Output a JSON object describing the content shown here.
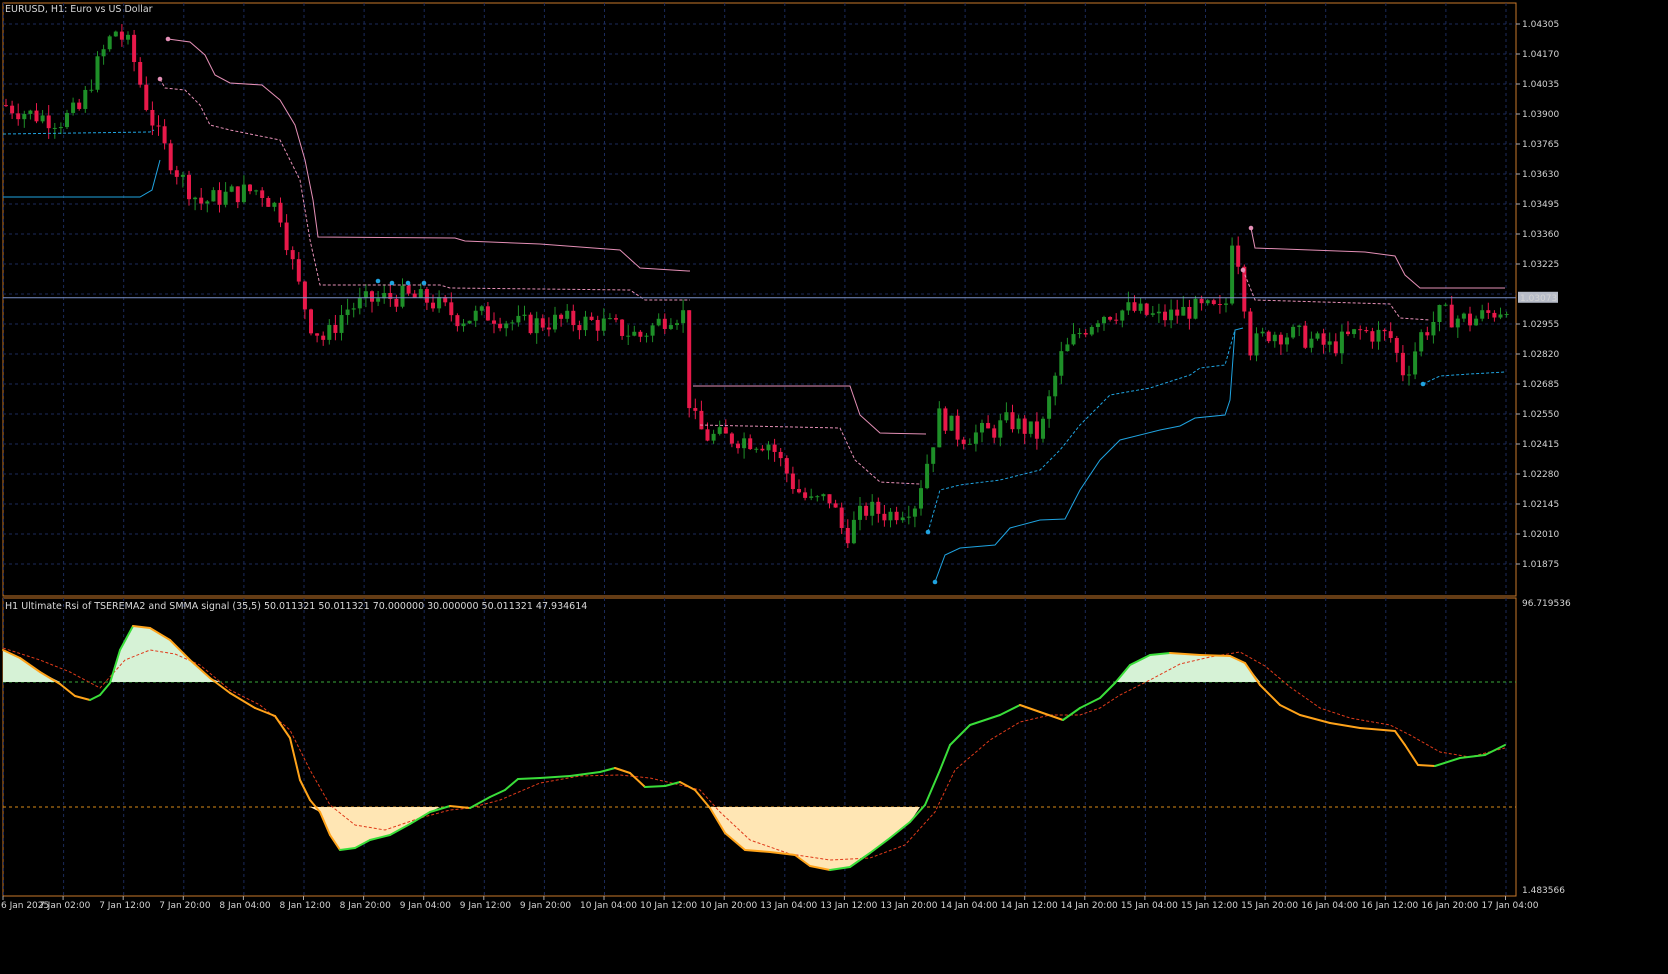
{
  "chart": {
    "title": "EURUSD, H1:  Euro vs US Dollar",
    "current_price": "1.03073",
    "price_axis": [
      "1.04305",
      "1.04170",
      "1.04035",
      "1.03900",
      "1.03765",
      "1.03630",
      "1.03495",
      "1.03360",
      "1.03225",
      "1.02955",
      "1.02820",
      "1.02685",
      "1.02550",
      "1.02415",
      "1.02280",
      "1.02145",
      "1.02010",
      "1.01875"
    ],
    "time_axis": [
      "6 Jan 2025",
      "7 Jan 02:00",
      "7 Jan 12:00",
      "7 Jan 20:00",
      "8 Jan 04:00",
      "8 Jan 12:00",
      "8 Jan 20:00",
      "9 Jan 04:00",
      "9 Jan 12:00",
      "9 Jan 20:00",
      "10 Jan 04:00",
      "10 Jan 12:00",
      "10 Jan 20:00",
      "13 Jan 04:00",
      "13 Jan 12:00",
      "13 Jan 20:00",
      "14 Jan 04:00",
      "14 Jan 12:00",
      "14 Jan 20:00",
      "15 Jan 04:00",
      "15 Jan 12:00",
      "15 Jan 20:00",
      "16 Jan 04:00",
      "16 Jan 12:00",
      "16 Jan 20:00",
      "17 Jan 04:00"
    ]
  },
  "indicator": {
    "title": "H1 Ultimate Rsi of TSEREMA2 and SMMA signal (35,5) 50.011321 50.011321 70.000000 30.000000 50.011321 47.934614",
    "scale_max": "96.719536",
    "scale_min": "1.483566"
  },
  "colors": {
    "background": "#000000",
    "grid": "#1b2a5a",
    "frame": "#c8782a",
    "bull_candle": "#1e8f28",
    "bear_candle": "#e8194a",
    "upper_band": "#e48fb6",
    "lower_band": "#1fa3e0",
    "price_line": "#7b8fc8",
    "rsi_up": "#3ade3a",
    "rsi_down": "#ffa31a",
    "signal": "#e03a1a",
    "ob_fill": "#d6f2d6",
    "os_fill": "#ffe6b4"
  }
}
